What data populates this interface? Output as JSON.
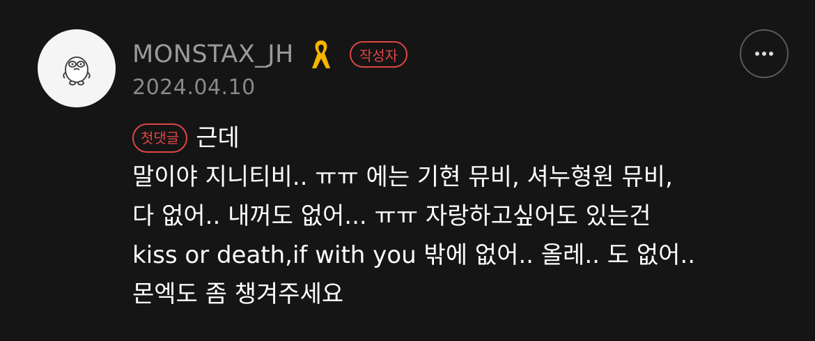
{
  "comment": {
    "author": "MONSTAX_JH",
    "author_badge": "작성자",
    "date": "2024.04.10",
    "first_comment_badge": "첫댓글",
    "lines": [
      "근데",
      "말이야 지니티비.. ㅠㅠ 에는 기현 뮤비, 셔누형원 뮤비,",
      "다 없어.. 내꺼도 없어... ㅠㅠ 자랑하고싶어도 있는건",
      "kiss or death,if with you 밖에 없어.. 올레.. 도 없어..",
      "몬엑도 좀 챙겨주세요"
    ],
    "icons": {
      "avatar": "character-avatar-icon",
      "ribbon": "yellow-ribbon-icon",
      "more": "more-options-icon"
    },
    "colors": {
      "background": "#151515",
      "badge_red": "#e04646",
      "ribbon_yellow": "#f4b400"
    }
  }
}
